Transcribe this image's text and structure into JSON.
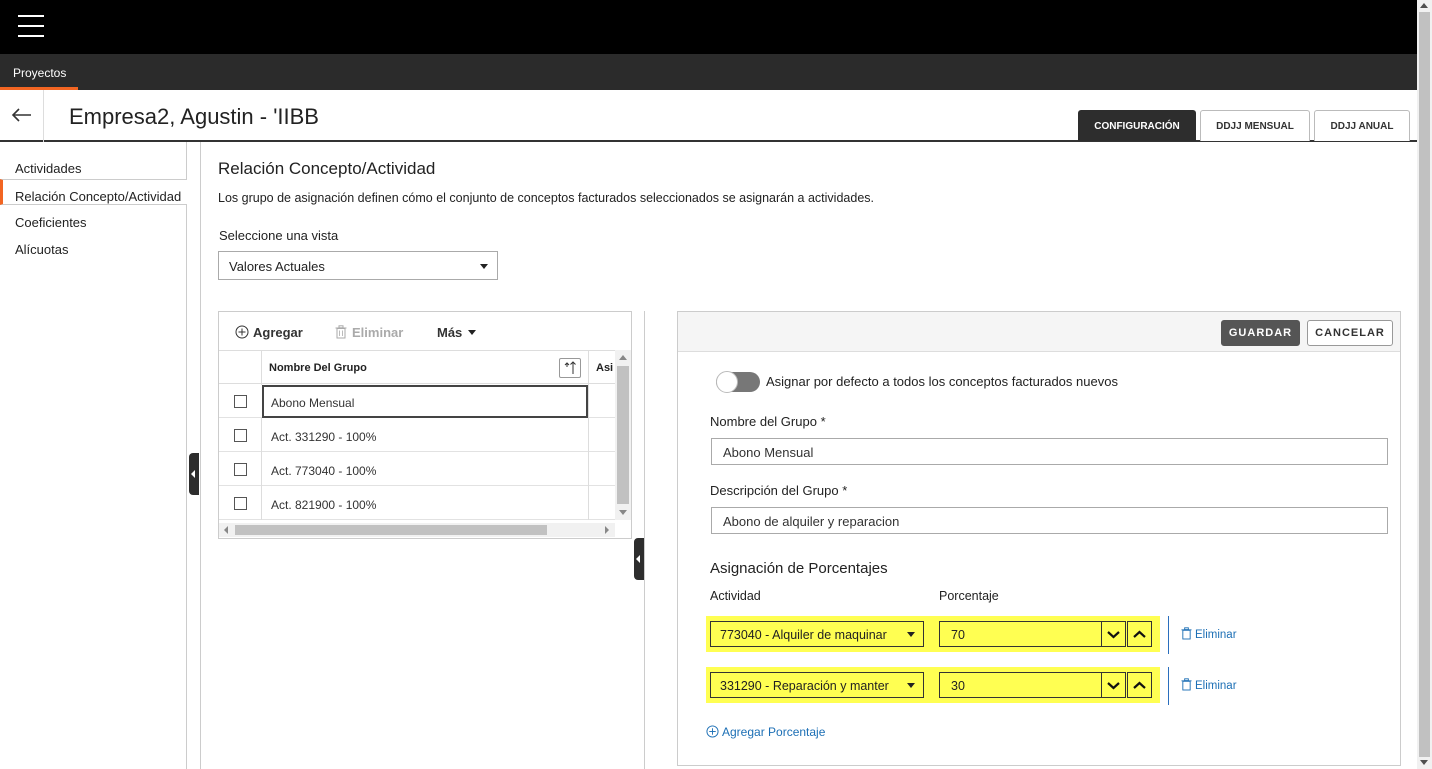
{
  "nav": {
    "tab_label": "Proyectos"
  },
  "header": {
    "title": "Empresa2, Agustin - 'IIBB",
    "tabs": [
      {
        "label": "CONFIGURACIÓN",
        "active": true
      },
      {
        "label": "DDJJ MENSUAL",
        "active": false
      },
      {
        "label": "DDJJ ANUAL",
        "active": false
      }
    ]
  },
  "sidebar": {
    "items": [
      {
        "label": "Actividades"
      },
      {
        "label": "Relación Concepto/Actividad",
        "active": true
      },
      {
        "label": "Coeficientes"
      },
      {
        "label": "Alícuotas"
      }
    ]
  },
  "main": {
    "section_title": "Relación Concepto/Actividad",
    "description": "Los grupo de asignación definen cómo el conjunto de conceptos facturados seleccionados se asignarán a actividades.",
    "view_label": "Seleccione una vista",
    "view_value": "Valores Actuales"
  },
  "grid": {
    "toolbar": {
      "add": "Agregar",
      "delete": "Eliminar",
      "more": "Más"
    },
    "columns": [
      "Nombre Del Grupo",
      "Asi"
    ],
    "rows": [
      {
        "name": "Abono Mensual"
      },
      {
        "name": "Act. 331290 - 100%"
      },
      {
        "name": "Act. 773040 - 100%"
      },
      {
        "name": "Act. 821900 - 100%"
      }
    ]
  },
  "form": {
    "save_label": "GUARDAR",
    "cancel_label": "CANCELAR",
    "toggle_label": "Asignar por defecto a todos los conceptos facturados nuevos",
    "group_name_label": "Nombre del Grupo",
    "group_name_value": "Abono Mensual",
    "group_desc_label": "Descripción del Grupo",
    "group_desc_value": "Abono de alquiler y reparacion",
    "required_mark": "*",
    "pct_title": "Asignación de Porcentajes",
    "col_activity": "Actividad",
    "col_percentage": "Porcentaje",
    "assignments": [
      {
        "activity": "773040 - Alquiler de maquinar",
        "percentage": "70",
        "delete_label": "Eliminar"
      },
      {
        "activity": "331290 - Reparación y manter",
        "percentage": "30",
        "delete_label": "Eliminar"
      }
    ],
    "add_pct_label": "Agregar Porcentaje"
  },
  "colors": {
    "accent": "#f26522",
    "highlight": "#ffff52",
    "link": "#1c6fb5",
    "topbar": "#000000",
    "navbar": "#2b2b2b"
  },
  "icons": [
    "hamburger-menu-icon",
    "back-arrow-icon",
    "add-circle-icon",
    "trash-icon",
    "caret-down-icon",
    "sort-icon",
    "chevron-down-icon",
    "chevron-up-icon",
    "collapse-left-icon"
  ]
}
